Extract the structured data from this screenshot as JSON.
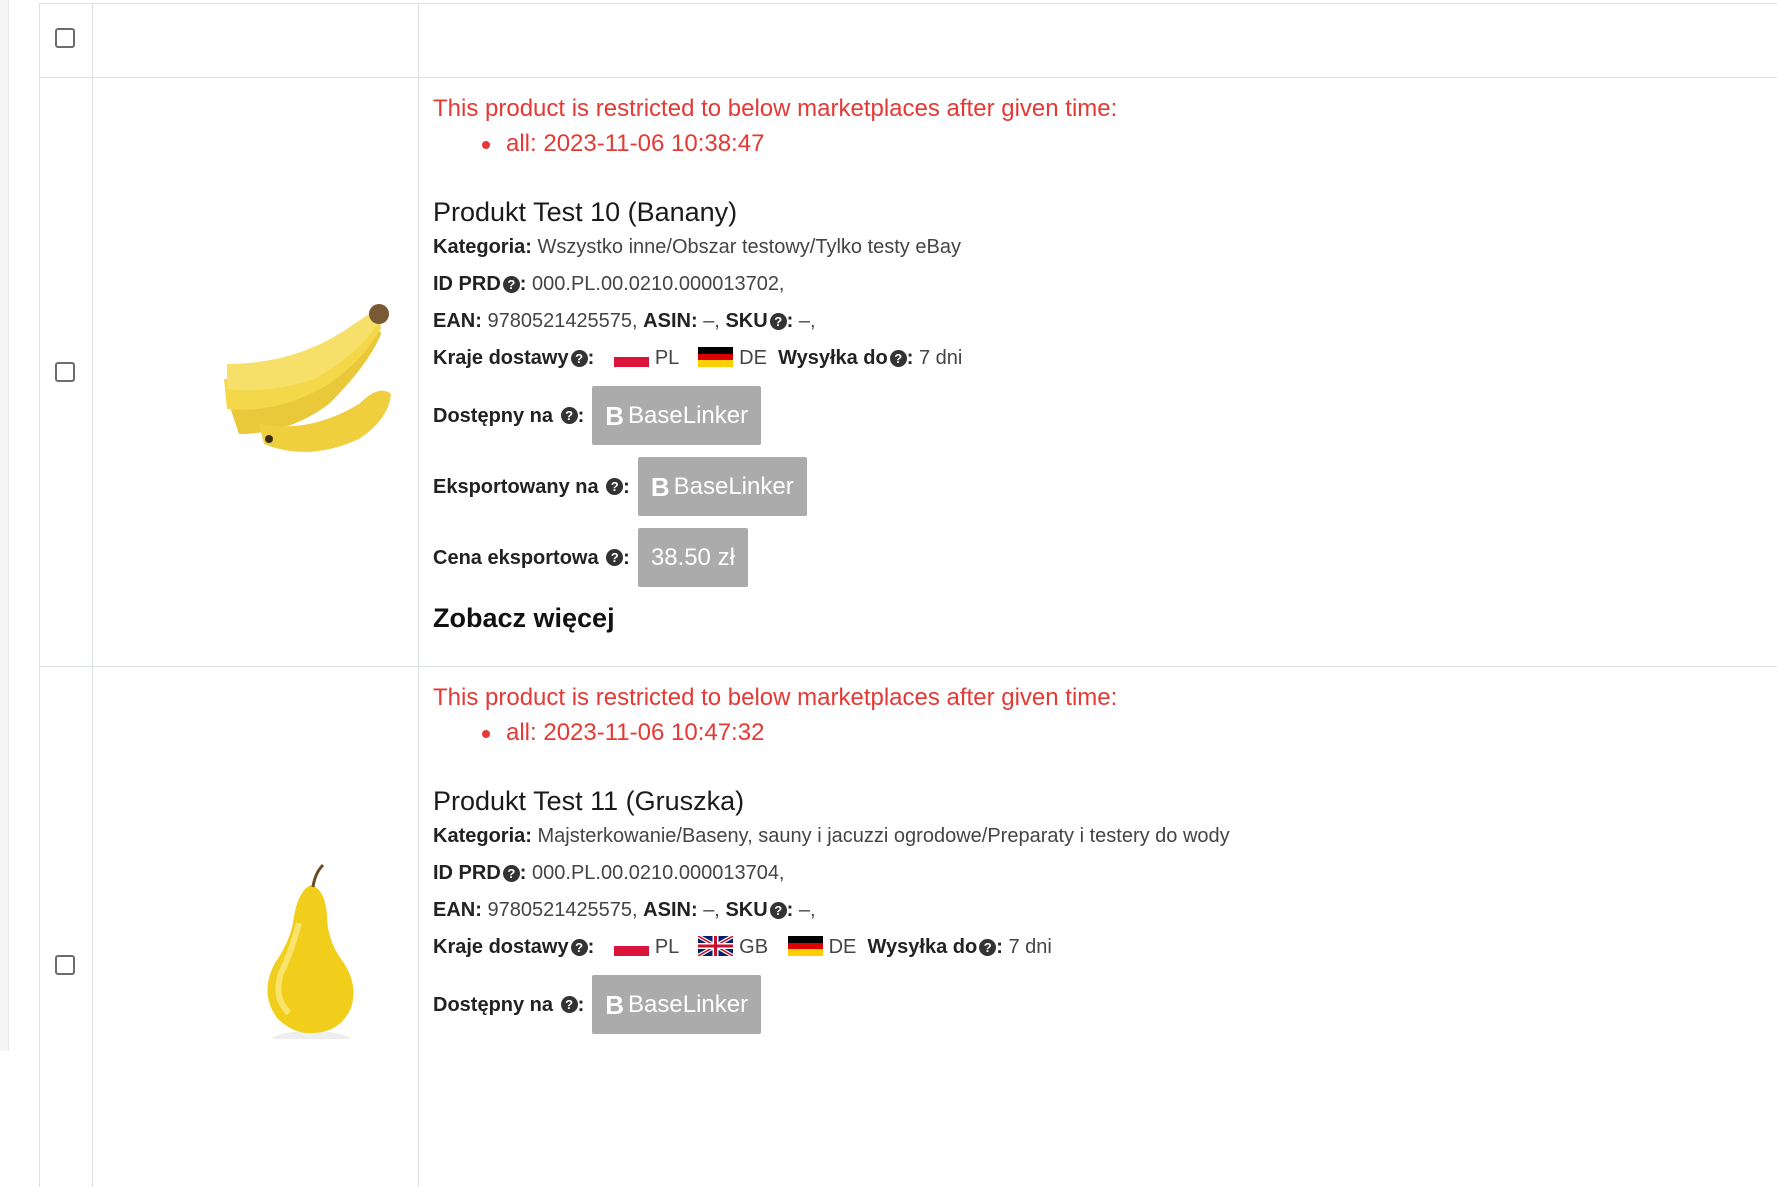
{
  "products": [
    {
      "restricted_text": "This product is restricted to below marketplaces after given time:",
      "restriction": "all: 2023-11-06 10:38:47",
      "title": "Produkt Test 10 (Banany)",
      "category_label": "Kategoria:",
      "category": "Wszystko inne/Obszar testowy/Tylko testy eBay",
      "id_label": "ID PRD",
      "id_value": "000.PL.00.0210.000013702,",
      "ean_label": "EAN:",
      "ean_value": "9780521425575,",
      "asin_label": "ASIN:",
      "asin_value": "–,",
      "sku_label": "SKU",
      "sku_value": "–,",
      "countries_label": "Kraje dostawy",
      "countries": [
        "PL",
        "DE"
      ],
      "shipping_label": "Wysyłka do",
      "shipping_value": "7 dni",
      "available_label": "Dostępny na",
      "available_on": "BaseLinker",
      "exported_label": "Eksportowany na",
      "exported_on": "BaseLinker",
      "price_label": "Cena eksportowa",
      "price": "38.50 zł",
      "see_more": "Zobacz więcej"
    },
    {
      "restricted_text": "This product is restricted to below marketplaces after given time:",
      "restriction": "all: 2023-11-06 10:47:32",
      "title": "Produkt Test 11 (Gruszka)",
      "category_label": "Kategoria:",
      "category": "Majsterkowanie/Baseny, sauny i jacuzzi ogrodowe/Preparaty i testery do wody",
      "id_label": "ID PRD",
      "id_value": "000.PL.00.0210.000013704,",
      "ean_label": "EAN:",
      "ean_value": "9780521425575,",
      "asin_label": "ASIN:",
      "asin_value": "–,",
      "sku_label": "SKU",
      "sku_value": "–,",
      "countries_label": "Kraje dostawy",
      "countries": [
        "PL",
        "GB",
        "DE"
      ],
      "shipping_label": "Wysyłka do",
      "shipping_value": "7 dni",
      "available_label": "Dostępny na",
      "available_on": "BaseLinker"
    }
  ],
  "colors": {
    "restricted": "#e53935",
    "badge": "#ababab"
  },
  "icons": {
    "help": "question-circle-icon",
    "logo": "baselinker-b-icon"
  }
}
